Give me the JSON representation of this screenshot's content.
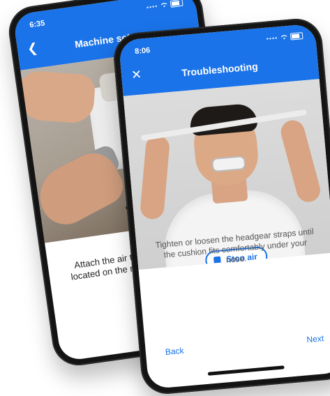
{
  "back_phone": {
    "time": "6:35",
    "title": "Machine setup",
    "instruction": "Attach the air tubing to the outlet located on the rear of the machine."
  },
  "front_phone": {
    "time": "8:06",
    "title": "Troubleshooting",
    "stop_air_label": "Stop air",
    "instruction": "Tighten or loosen the headgear straps until the cushion fits comfortably under your nose.",
    "back_label": "Back",
    "next_label": "Next"
  },
  "colors": {
    "accent": "#1a73e8"
  }
}
